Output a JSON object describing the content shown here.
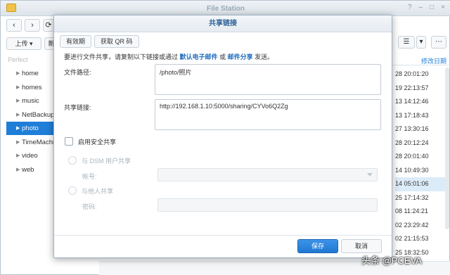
{
  "app": {
    "title": "File Station"
  },
  "toolbar": {
    "upload_label": "上传",
    "new_label": "新"
  },
  "sidebar": {
    "root_label": "Perfect",
    "items": [
      {
        "label": "home"
      },
      {
        "label": "homes"
      },
      {
        "label": "music"
      },
      {
        "label": "NetBackup"
      },
      {
        "label": "photo",
        "selected": true
      },
      {
        "label": "TimeMachine"
      },
      {
        "label": "video"
      },
      {
        "label": "web"
      }
    ]
  },
  "file_list": {
    "modified_header": "修改日期",
    "dates": [
      "28 20:01:20",
      "19 22:13:57",
      "13 14:12:46",
      "13 17:18:43",
      "27 13:30:16",
      "28 20:12:24",
      "28 20:01:40",
      "14 10:49:30",
      "14 05:01:06",
      "25 17:14:32",
      "08 11:24:21",
      "02 23:29:42",
      "02 21:15:53",
      "25 18:32:50"
    ]
  },
  "dialog": {
    "title": "共享链接",
    "tabs": [
      "有效期",
      "获取 QR 码"
    ],
    "description": {
      "prefix": "要进行文件共享，请复制以下链接或通过",
      "link1": "默认电子邮件",
      "middle": "或",
      "link2": "邮件分享",
      "suffix": "发送。"
    },
    "file_path_label": "文件路径:",
    "file_path_value": "/photo/照片",
    "share_link_label": "共享链接:",
    "share_link_value": "http://192.168.1.10:5000/sharing/CYVo6Q2Zg",
    "secure_share_label": "启用安全共享",
    "dsm_user_share_label": "与 DSM 用户共享",
    "account_label": "帐号:",
    "others_share_label": "与他人共享",
    "password_label": "密码:",
    "save_label": "保存",
    "cancel_label": "取消"
  },
  "watermark": "头条 @PCEVA",
  "colors": {
    "accent": "#1e7ed8",
    "link": "#1e6cbf",
    "title": "#2a5f95"
  }
}
